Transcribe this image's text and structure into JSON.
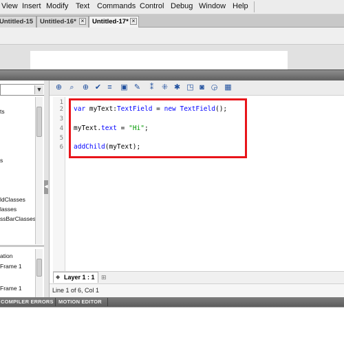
{
  "menu": [
    "View",
    "Insert",
    "Modify",
    "Text",
    "Commands",
    "Control",
    "Debug",
    "Window",
    "Help"
  ],
  "doc_tabs": [
    {
      "label": "Untitled-15",
      "active": false
    },
    {
      "label": "Untitled-16*",
      "active": false
    },
    {
      "label": "Untitled-17*",
      "active": true
    }
  ],
  "left_tree": {
    "top_items": [
      "ts",
      "s",
      "ldClasses",
      "lasses",
      "ssBarClasses"
    ],
    "bottom_items": [
      "ation",
      "Frame 1",
      "Frame 1"
    ]
  },
  "toolbar_icons": [
    "add-statement-icon",
    "find-icon",
    "insert-target-path-icon",
    "check-syntax-icon",
    "auto-format-icon",
    "show-code-hint-icon",
    "debug-options-icon",
    "collapse-between-braces-icon",
    "collapse-selection-icon",
    "expand-all-icon",
    "apply-block-comment-icon",
    "apply-line-comment-icon",
    "remove-comment-icon",
    "show-hide-toolbox-icon"
  ],
  "editor": {
    "line_numbers": [
      "1",
      "2",
      "3",
      "4",
      "5",
      "6"
    ],
    "lines": [
      {
        "kw": "",
        "text": ""
      },
      {
        "kw": "var",
        "name": " myText:",
        "type": "TextField",
        "rest": " = ",
        "kw2": "new",
        "type2": " TextField",
        "end": "();"
      },
      {
        "kw": "",
        "text": ""
      },
      {
        "obj": "myText.",
        "prop": "text",
        "op": " = ",
        "str": "\"Hi\"",
        "end": ";"
      },
      {
        "kw": "",
        "text": ""
      },
      {
        "fn": "addChild",
        "args": "(myText);"
      }
    ]
  },
  "layer_tab": "Layer 1 : 1",
  "status": "Line 1 of 6, Col 1",
  "bottom_tabs": [
    "COMPILER ERRORS",
    "MOTION EDITOR"
  ],
  "colors": {
    "highlight": "#e8141a",
    "keyword": "#0000ff",
    "string": "#009900"
  }
}
